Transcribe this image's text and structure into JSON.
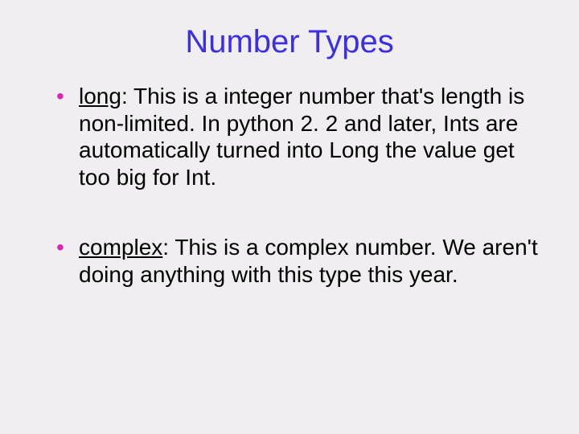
{
  "title": "Number Types",
  "bullets": [
    {
      "term": "long",
      "desc": ": This is a integer number that's length is non-limited. In python 2. 2 and later, Ints are automatically turned into Long the value get too big for Int."
    },
    {
      "term": "complex",
      "desc": ": This is a complex number.  We aren't doing anything with this type this year."
    }
  ]
}
